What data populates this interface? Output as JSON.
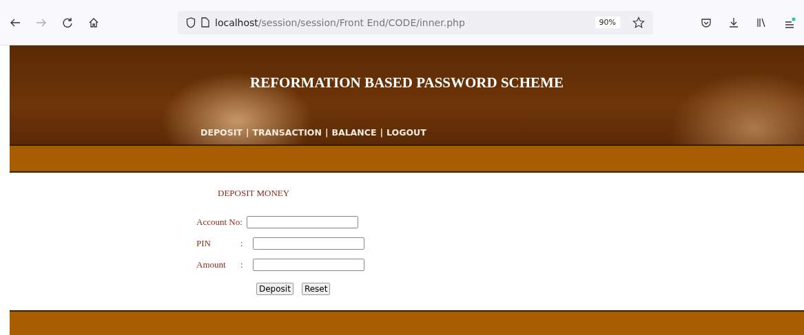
{
  "browser": {
    "url_host": "localhost",
    "url_path": "/session/session/Front End/CODE/inner.php",
    "zoom": "90%"
  },
  "header": {
    "title": "REFORMATION BASED PASSWORD SCHEME",
    "separator": "|",
    "nav": [
      {
        "label": "DEPOSIT"
      },
      {
        "label": "TRANSACTION"
      },
      {
        "label": "BALANCE"
      },
      {
        "label": "LOGOUT"
      }
    ]
  },
  "form": {
    "heading": "DEPOSIT MONEY",
    "fields": [
      {
        "label": "Account No:"
      },
      {
        "label": "PIN",
        "separator": ":"
      },
      {
        "label": "Amount",
        "separator": ":"
      }
    ],
    "buttons": [
      "Deposit",
      "Reset"
    ]
  }
}
